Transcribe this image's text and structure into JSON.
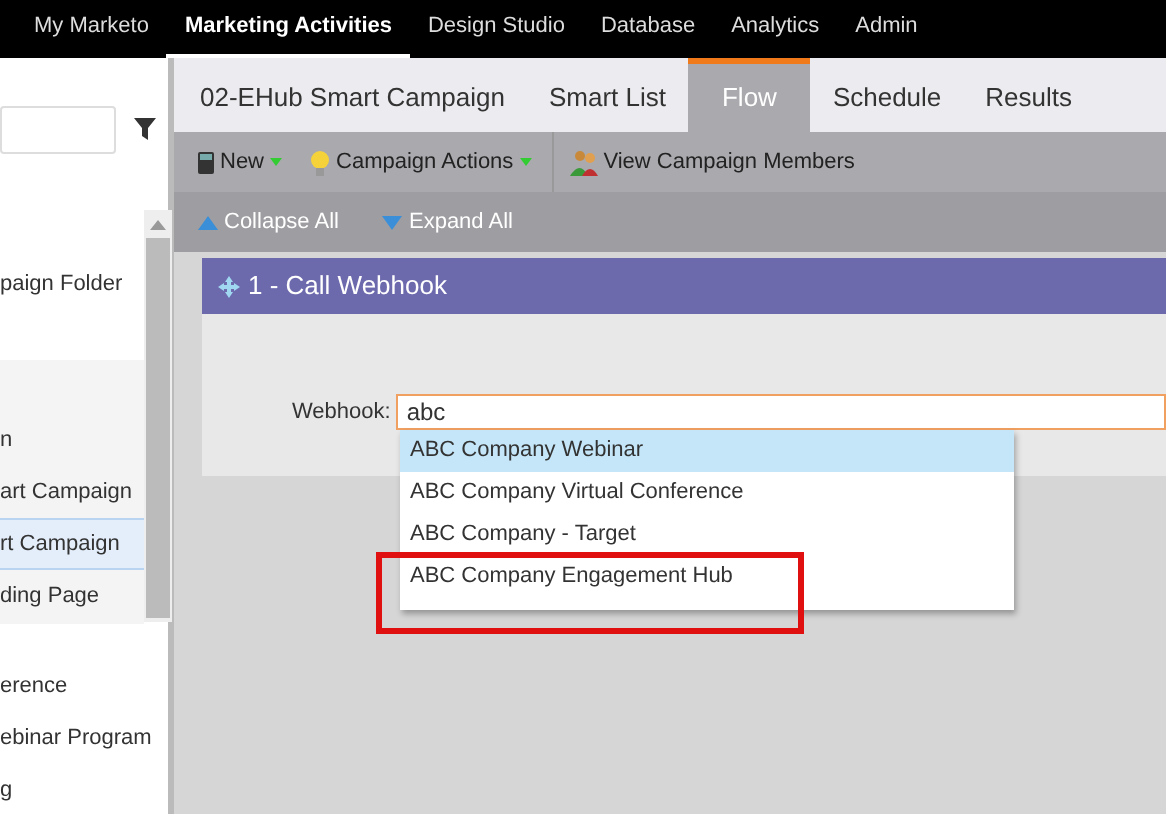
{
  "top_nav": [
    {
      "label": "My Marketo",
      "selected": false
    },
    {
      "label": "Marketing Activities",
      "selected": true
    },
    {
      "label": "Design Studio",
      "selected": false
    },
    {
      "label": "Database",
      "selected": false
    },
    {
      "label": "Analytics",
      "selected": false
    },
    {
      "label": "Admin",
      "selected": false
    }
  ],
  "sidebar": {
    "sections": [
      {
        "shaded": false,
        "items": [
          {
            "label": "paign Folder",
            "selected": false
          }
        ]
      },
      {
        "shaded": true,
        "items": [
          {
            "label": "n",
            "selected": false
          },
          {
            "label": "art Campaign",
            "selected": false
          },
          {
            "label": "rt Campaign",
            "selected": true
          },
          {
            "label": "ding Page",
            "selected": false
          }
        ]
      },
      {
        "shaded": false,
        "items": [
          {
            "label": "erence",
            "selected": false
          },
          {
            "label": "ebinar Program",
            "selected": false
          },
          {
            "label": "g",
            "selected": false
          }
        ]
      }
    ]
  },
  "tabs": [
    {
      "label": "02-EHub Smart Campaign",
      "selected": false
    },
    {
      "label": "Smart List",
      "selected": false
    },
    {
      "label": "Flow",
      "selected": true
    },
    {
      "label": "Schedule",
      "selected": false
    },
    {
      "label": "Results",
      "selected": false
    }
  ],
  "toolbar": [
    {
      "kind": "new",
      "label": "New",
      "menu": true
    },
    {
      "kind": "actions",
      "label": "Campaign Actions",
      "menu": true
    },
    {
      "kind": "members",
      "label": "View Campaign Members",
      "menu": false
    }
  ],
  "subtoolbar": [
    {
      "kind": "collapse",
      "label": "Collapse All"
    },
    {
      "kind": "expand",
      "label": "Expand All"
    }
  ],
  "flow_step": {
    "title": "1 - Call Webhook",
    "field_label": "Webhook:",
    "value": "abc",
    "suggestions": [
      {
        "label": "ABC Company Webinar",
        "selected": true,
        "highlighted": false
      },
      {
        "label": "ABC Company Virtual Conference",
        "selected": false,
        "highlighted": false
      },
      {
        "label": "ABC Company - Target",
        "selected": false,
        "highlighted": false
      },
      {
        "label": "ABC Company Engagement Hub",
        "selected": false,
        "highlighted": true
      }
    ]
  }
}
